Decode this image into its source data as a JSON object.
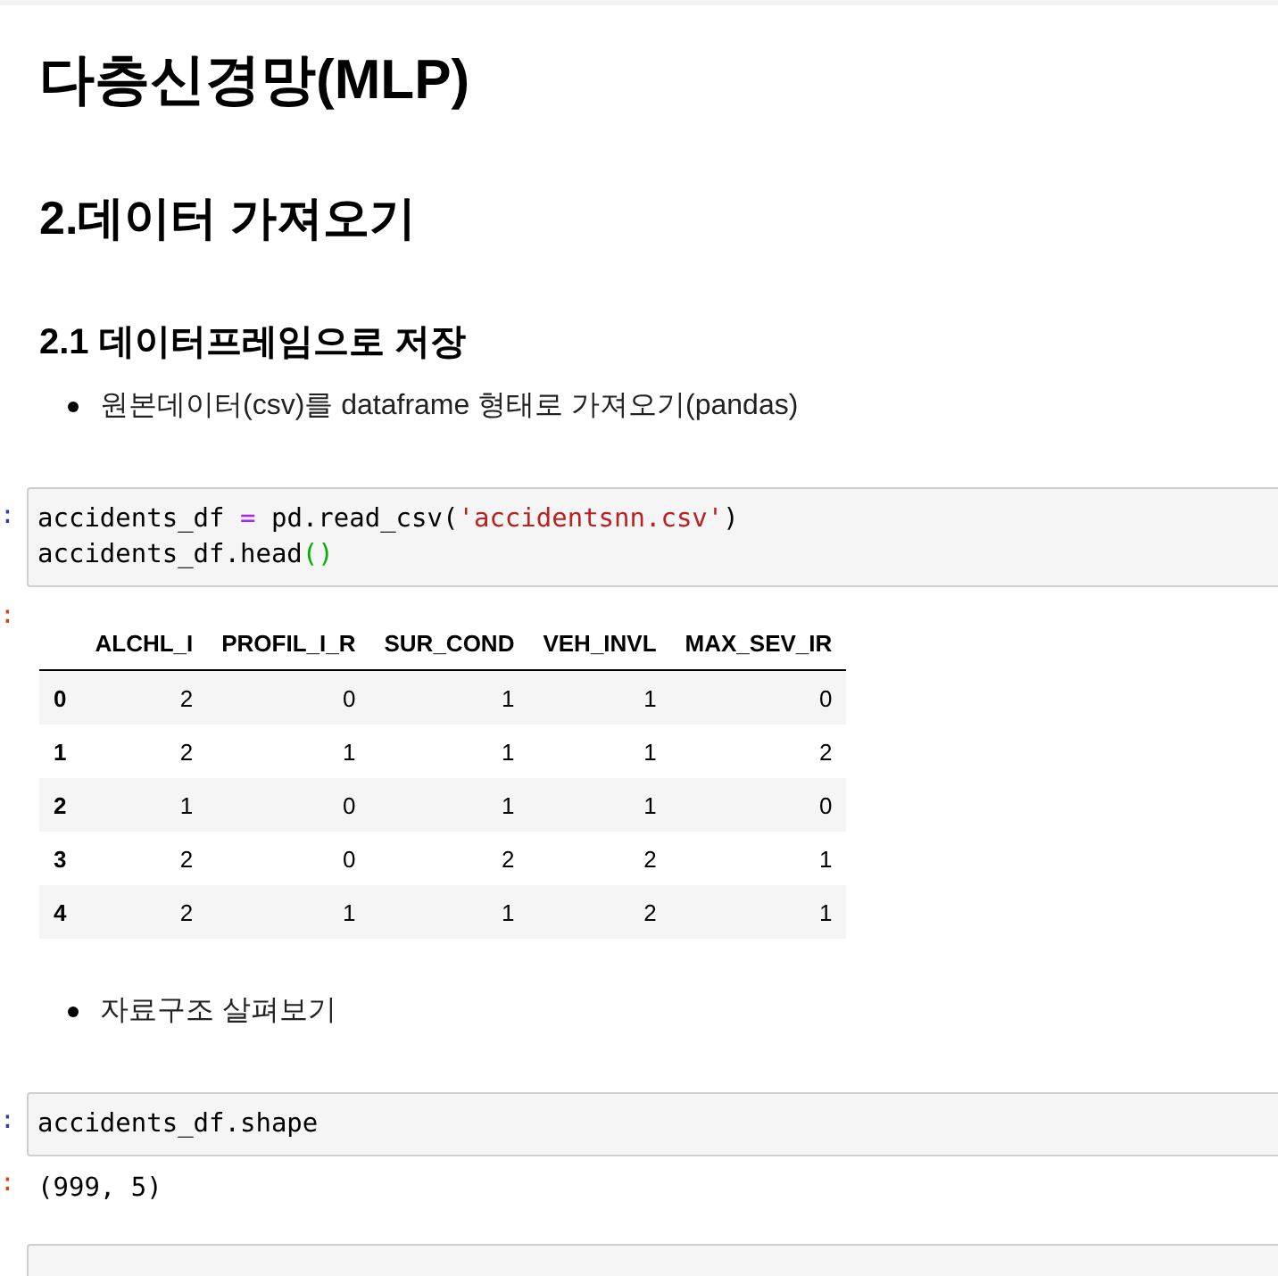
{
  "cells": [
    {
      "kind": "markdown",
      "blocks": [
        {
          "kind": "h1",
          "text": "다층신경망(MLP)"
        },
        {
          "kind": "h2",
          "text": "2.데이터 가져오기"
        },
        {
          "kind": "h3",
          "text": "2.1 데이터프레임으로 저장"
        },
        {
          "kind": "bullet",
          "text": "원본데이터(csv)를 dataframe 형태로 가져오기(pandas)"
        }
      ]
    },
    {
      "kind": "code",
      "prompt": ":",
      "lines": [
        [
          {
            "kind": "name",
            "text": "accidents_df "
          },
          {
            "kind": "operator",
            "text": "="
          },
          {
            "kind": "name",
            "text": " pd.read_csv("
          },
          {
            "kind": "string",
            "text": "'accidentsnn.csv'"
          },
          {
            "kind": "name",
            "text": ")"
          }
        ],
        [
          {
            "kind": "name",
            "text": "accidents_df.head"
          },
          {
            "kind": "paren",
            "text": "()"
          }
        ]
      ]
    },
    {
      "kind": "table_output",
      "prompt": ":",
      "table": {
        "columns": [
          "ALCHL_I",
          "PROFIL_I_R",
          "SUR_COND",
          "VEH_INVL",
          "MAX_SEV_IR"
        ],
        "rows": [
          {
            "index": "0",
            "cells": [
              "2",
              "0",
              "1",
              "1",
              "0"
            ]
          },
          {
            "index": "1",
            "cells": [
              "2",
              "1",
              "1",
              "1",
              "2"
            ]
          },
          {
            "index": "2",
            "cells": [
              "1",
              "0",
              "1",
              "1",
              "0"
            ]
          },
          {
            "index": "3",
            "cells": [
              "2",
              "0",
              "2",
              "2",
              "1"
            ]
          },
          {
            "index": "4",
            "cells": [
              "2",
              "1",
              "1",
              "2",
              "1"
            ]
          }
        ]
      }
    },
    {
      "kind": "markdown",
      "blocks": [
        {
          "kind": "bullet",
          "text": "자료구조 살펴보기"
        }
      ]
    },
    {
      "kind": "code",
      "prompt": ":",
      "lines": [
        [
          {
            "kind": "name",
            "text": "accidents_df.shape"
          }
        ]
      ]
    },
    {
      "kind": "text_output",
      "prompt": ":",
      "text": "(999, 5)"
    },
    {
      "kind": "code"
    }
  ]
}
